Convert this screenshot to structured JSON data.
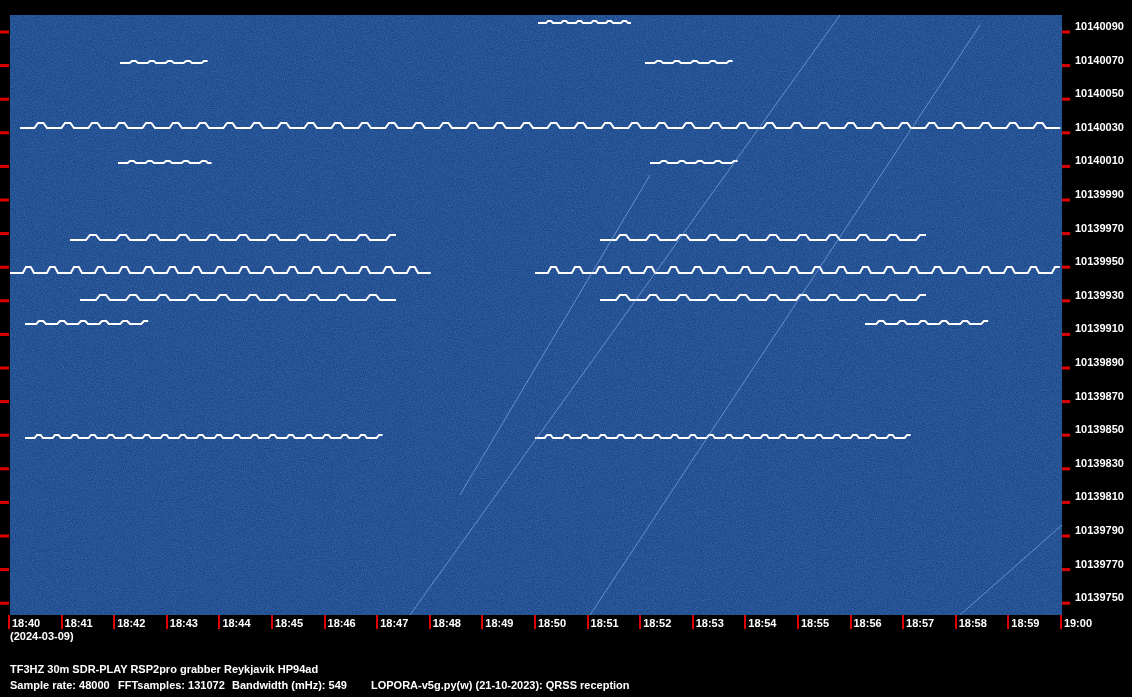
{
  "frequency_axis": {
    "labels": [
      "10140090",
      "10140070",
      "10140050",
      "10140030",
      "10140010",
      "10139990",
      "10139970",
      "10139950",
      "10139930",
      "10139910",
      "10139890",
      "10139870",
      "10139850",
      "10139830",
      "10139810",
      "10139790",
      "10139770",
      "10139750"
    ]
  },
  "time_axis": {
    "labels": [
      "18:40",
      "18:41",
      "18:42",
      "18:43",
      "18:44",
      "18:45",
      "18:46",
      "18:47",
      "18:48",
      "18:49",
      "18:50",
      "18:51",
      "18:52",
      "18:53",
      "18:54",
      "18:55",
      "18:56",
      "18:57",
      "18:58",
      "18:59",
      "19:00"
    ],
    "date": "(2024-03-09)"
  },
  "station": "TF3HZ 30m SDR-PLAY RSP2pro grabber Reykjavik HP94ad",
  "info": [
    "Sample rate: 48000",
    "FFTsamples: 131072",
    "Bandwidth (mHz): 549",
    "LOPORA-v5g.py(w) (21-10-2023): QRSS reception"
  ]
}
